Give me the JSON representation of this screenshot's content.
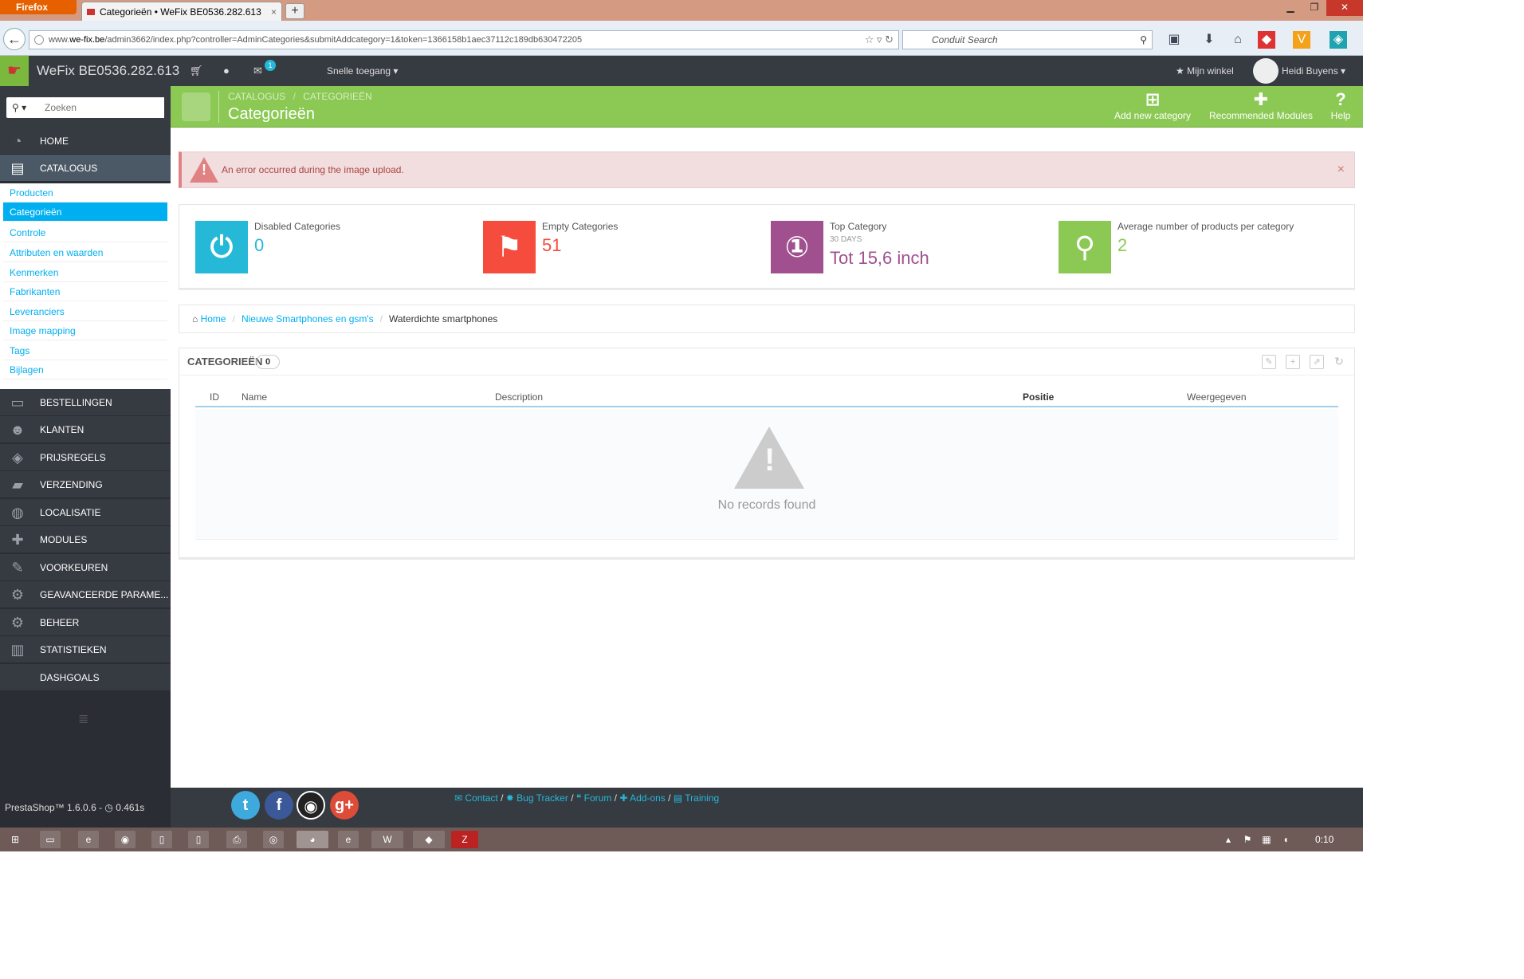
{
  "browser": {
    "menu_label": "Firefox",
    "tab_title": "Categorieën • WeFix BE0536.282.613",
    "url_prefix": "www.",
    "url_domain": "we-fix.be",
    "url_rest": "/admin3662/index.php?controller=AdminCategories&submitAddcategory=1&token=1366158b1aec37112c189db630472205",
    "search_placeholder": "Conduit Search"
  },
  "header": {
    "shop_name": "WeFix BE0536.282.613",
    "mail_badge": "1",
    "quick_access": "Snelle toegang",
    "my_shop": "Mijn winkel",
    "user_name": "Heidi Buyens"
  },
  "sidebar": {
    "search_placeholder": "Zoeken",
    "home": "HOME",
    "catalog": "CATALOGUS",
    "sub_items": [
      "Producten",
      "Categorieën",
      "Controle",
      "Attributen en waarden",
      "Kenmerken",
      "Fabrikanten",
      "Leveranciers",
      "Image mapping",
      "Tags",
      "Bijlagen"
    ],
    "items": [
      "BESTELLINGEN",
      "KLANTEN",
      "PRIJSREGELS",
      "VERZENDING",
      "LOCALISATIE",
      "MODULES",
      "VOORKEUREN",
      "GEAVANCEERDE PARAME...",
      "BEHEER",
      "STATISTIEKEN",
      "DASHGOALS"
    ]
  },
  "toolbar": {
    "crumb_1": "CATALOGUS",
    "crumb_2": "CATEGORIEËN",
    "title": "Categorieën",
    "add_new": "Add new category",
    "recommended": "Recommended Modules",
    "help": "Help"
  },
  "alert": {
    "message": "An error occurred during the image upload."
  },
  "kpis": [
    {
      "label": "Disabled Categories",
      "value": "0",
      "color": "#25b9d7"
    },
    {
      "label": "Empty Categories",
      "value": "51",
      "color": "#f54c3e"
    },
    {
      "label": "Top Category",
      "sub": "30 DAYS",
      "value": "Tot 15,6 inch",
      "color": "#a0508f"
    },
    {
      "label": "Average number of products per category",
      "value": "2",
      "color": "#8bc954"
    }
  ],
  "breadcrumb": [
    "Home",
    "Nieuwe Smartphones en gsm's",
    "Waterdichte smartphones"
  ],
  "panel": {
    "title": "CATEGORIEËN",
    "count": "0",
    "columns": [
      "ID",
      "Name",
      "Description",
      "Positie",
      "Weergegeven"
    ],
    "empty_text": "No records found"
  },
  "footer": {
    "version": "PrestaShop™ 1.6.0.6 - ",
    "time": "0.461s",
    "links": [
      "Contact",
      "Bug Tracker",
      "Forum",
      "Add-ons",
      "Training"
    ]
  },
  "taskbar": {
    "clock": "0:10"
  }
}
